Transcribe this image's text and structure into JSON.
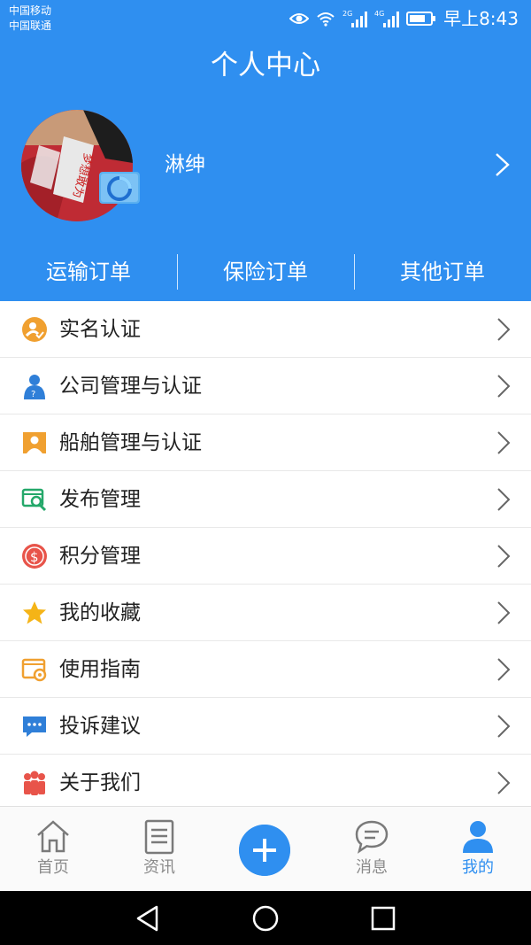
{
  "status_bar": {
    "carrier_1": "中国移动",
    "carrier_2": "中国联通",
    "net_1": "2G",
    "net_2": "4G",
    "time": "早上8:43"
  },
  "header": {
    "title": "个人中心"
  },
  "profile": {
    "username": "淋绅",
    "avatar_text": "梦想敢为"
  },
  "orders": [
    {
      "label": "运输订单"
    },
    {
      "label": "保险订单"
    },
    {
      "label": "其他订单"
    }
  ],
  "menu": [
    {
      "label": "实名认证",
      "icon": "realname-verify-icon"
    },
    {
      "label": "公司管理与认证",
      "icon": "company-user-icon"
    },
    {
      "label": "船舶管理与认证",
      "icon": "ship-badge-icon"
    },
    {
      "label": "发布管理",
      "icon": "publish-search-icon"
    },
    {
      "label": "积分管理",
      "icon": "points-coin-icon"
    },
    {
      "label": "我的收藏",
      "icon": "star-icon"
    },
    {
      "label": "使用指南",
      "icon": "guide-gear-icon"
    },
    {
      "label": "投诉建议",
      "icon": "chat-bubble-icon"
    },
    {
      "label": "关于我们",
      "icon": "team-icon"
    }
  ],
  "tabs": [
    {
      "label": "首页",
      "icon": "home-icon"
    },
    {
      "label": "资讯",
      "icon": "news-icon"
    },
    {
      "label": "",
      "icon": "plus-icon"
    },
    {
      "label": "消息",
      "icon": "message-icon"
    },
    {
      "label": "我的",
      "icon": "user-icon",
      "active": true
    }
  ],
  "colors": {
    "primary": "#2f8ff0",
    "tab_inactive": "#8a8a8a",
    "orange": "#f0a030",
    "red": "#e8544a"
  }
}
